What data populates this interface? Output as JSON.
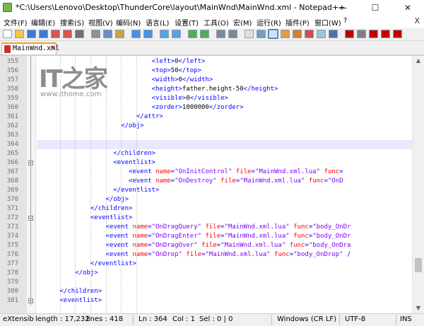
{
  "window": {
    "title": "*C:\\Users\\Lenovo\\Desktop\\ThunderCore\\layout\\MainWnd\\MainWnd.xml - Notepad++",
    "minimize_glyph": "—",
    "maximize_glyph": "☐",
    "close_glyph": "✕"
  },
  "menu": {
    "items": [
      "文件(F)",
      "编辑(E)",
      "搜索(S)",
      "视图(V)",
      "编码(N)",
      "语言(L)",
      "设置(T)",
      "工具(O)",
      "宏(M)",
      "运行(R)",
      "插件(P)",
      "窗口(W)",
      "?"
    ],
    "close_glyph": "X"
  },
  "toolbar": {
    "icons": [
      "new-file-icon",
      "open-file-icon",
      "save-icon",
      "save-all-icon",
      "close-icon",
      "close-all-icon",
      "print-icon",
      "cut-icon",
      "copy-icon",
      "paste-icon",
      "undo-icon",
      "redo-icon",
      "find-icon",
      "replace-icon",
      "zoom-in-icon",
      "zoom-out-icon",
      "sync-vertical-icon",
      "sync-horizontal-icon",
      "word-wrap-icon",
      "all-chars-icon",
      "indent-guide-icon",
      "udl-icon",
      "doc-map-icon",
      "function-list-icon",
      "folder-workspace-icon",
      "monitor-icon",
      "record-macro-icon",
      "stop-macro-icon",
      "play-macro-icon",
      "play-multiple-icon",
      "save-macro-icon"
    ],
    "colors": [
      "#ffffff",
      "#f5c542",
      "#3a7bd5",
      "#3a7bd5",
      "#d9534f",
      "#d9534f",
      "#707070",
      "#909090",
      "#6a8fc7",
      "#c9a24b",
      "#4a90e2",
      "#4a90e2",
      "#5aa0e0",
      "#5aa0e0",
      "#4caf50",
      "#4caf50",
      "#7a8a9a",
      "#7a8a9a",
      "#e0e0e0",
      "#7a9ac0",
      "#3a6ea5",
      "#e0a040",
      "#d08030",
      "#c95050",
      "#a0c0e0",
      "#5070a0",
      "#c00000",
      "#808080",
      "#c00000",
      "#c00000",
      "#c00000"
    ],
    "active_index": 20
  },
  "tab": {
    "label": "MainWnd.xml",
    "close_glyph": "✕"
  },
  "editor": {
    "current_line": 364,
    "lines": [
      {
        "n": "355",
        "indent": 30,
        "parts": [
          [
            "t",
            "<left>"
          ],
          [
            "x",
            "0"
          ],
          [
            "t",
            "</left>"
          ]
        ]
      },
      {
        "n": "356",
        "indent": 30,
        "parts": [
          [
            "t",
            "<top>"
          ],
          [
            "x",
            "50"
          ],
          [
            "t",
            "</top>"
          ]
        ]
      },
      {
        "n": "357",
        "indent": 30,
        "parts": [
          [
            "t",
            "<width>"
          ],
          [
            "x",
            "0"
          ],
          [
            "t",
            "</width>"
          ]
        ]
      },
      {
        "n": "358",
        "indent": 30,
        "parts": [
          [
            "t",
            "<height>"
          ],
          [
            "x",
            "father.height-50"
          ],
          [
            "t",
            "</height>"
          ]
        ]
      },
      {
        "n": "359",
        "indent": 30,
        "parts": [
          [
            "t",
            "<visible>"
          ],
          [
            "x",
            "0"
          ],
          [
            "t",
            "</visible>"
          ]
        ]
      },
      {
        "n": "360",
        "indent": 30,
        "parts": [
          [
            "t",
            "<zorder>"
          ],
          [
            "x",
            "1000000"
          ],
          [
            "t",
            "</zorder>"
          ]
        ]
      },
      {
        "n": "361",
        "indent": 26,
        "parts": [
          [
            "t",
            "</attr>"
          ]
        ]
      },
      {
        "n": "362",
        "indent": 22,
        "parts": [
          [
            "t",
            "</obj>"
          ]
        ]
      },
      {
        "n": "363",
        "indent": 0,
        "parts": []
      },
      {
        "n": "364",
        "indent": 0,
        "parts": []
      },
      {
        "n": "365",
        "indent": 20,
        "parts": [
          [
            "t",
            "</children>"
          ]
        ]
      },
      {
        "n": "366",
        "indent": 20,
        "parts": [
          [
            "t",
            "<eventlist>"
          ]
        ]
      },
      {
        "n": "367",
        "indent": 24,
        "parts": [
          [
            "t",
            "<event "
          ],
          [
            "a",
            "name"
          ],
          [
            "t",
            "="
          ],
          [
            "v",
            "\"OnInitControl\""
          ],
          [
            "t",
            " "
          ],
          [
            "a",
            "file"
          ],
          [
            "t",
            "="
          ],
          [
            "v",
            "\"MainWnd.xml.lua\""
          ],
          [
            "t",
            " "
          ],
          [
            "a",
            "func"
          ],
          [
            "t",
            "="
          ]
        ]
      },
      {
        "n": "368",
        "indent": 24,
        "parts": [
          [
            "t",
            "<event "
          ],
          [
            "a",
            "name"
          ],
          [
            "t",
            "="
          ],
          [
            "v",
            "\"OnDestroy\""
          ],
          [
            "t",
            " "
          ],
          [
            "a",
            "file"
          ],
          [
            "t",
            "="
          ],
          [
            "v",
            "\"MainWnd.xml.lua\""
          ],
          [
            "t",
            " "
          ],
          [
            "a",
            "func"
          ],
          [
            "t",
            "="
          ],
          [
            "v",
            "\"OnD"
          ]
        ]
      },
      {
        "n": "369",
        "indent": 20,
        "parts": [
          [
            "t",
            "</eventlist>"
          ]
        ]
      },
      {
        "n": "370",
        "indent": 18,
        "parts": [
          [
            "t",
            "</obj>"
          ]
        ]
      },
      {
        "n": "371",
        "indent": 14,
        "parts": [
          [
            "t",
            "</children>"
          ]
        ]
      },
      {
        "n": "372",
        "indent": 14,
        "parts": [
          [
            "t",
            "<eventlist>"
          ]
        ]
      },
      {
        "n": "373",
        "indent": 18,
        "parts": [
          [
            "t",
            "<event "
          ],
          [
            "a",
            "name"
          ],
          [
            "t",
            "="
          ],
          [
            "v",
            "\"OnDragQuery\""
          ],
          [
            "t",
            " "
          ],
          [
            "a",
            "file"
          ],
          [
            "t",
            "="
          ],
          [
            "v",
            "\"MainWnd.xml.lua\""
          ],
          [
            "t",
            " "
          ],
          [
            "a",
            "func"
          ],
          [
            "t",
            "="
          ],
          [
            "v",
            "\"body_OnDr"
          ]
        ]
      },
      {
        "n": "374",
        "indent": 18,
        "parts": [
          [
            "t",
            "<event "
          ],
          [
            "a",
            "name"
          ],
          [
            "t",
            "="
          ],
          [
            "v",
            "\"OnDragEnter\""
          ],
          [
            "t",
            " "
          ],
          [
            "a",
            "file"
          ],
          [
            "t",
            "="
          ],
          [
            "v",
            "\"MainWnd.xml.lua\""
          ],
          [
            "t",
            " "
          ],
          [
            "a",
            "func"
          ],
          [
            "t",
            "="
          ],
          [
            "v",
            "\"body_OnDr"
          ]
        ]
      },
      {
        "n": "375",
        "indent": 18,
        "parts": [
          [
            "t",
            "<event "
          ],
          [
            "a",
            "name"
          ],
          [
            "t",
            "="
          ],
          [
            "v",
            "\"OnDragOver\""
          ],
          [
            "t",
            " "
          ],
          [
            "a",
            "file"
          ],
          [
            "t",
            "="
          ],
          [
            "v",
            "\"MainWnd.xml.lua\""
          ],
          [
            "t",
            " "
          ],
          [
            "a",
            "func"
          ],
          [
            "t",
            "="
          ],
          [
            "v",
            "\"body_OnDra"
          ]
        ]
      },
      {
        "n": "376",
        "indent": 18,
        "parts": [
          [
            "t",
            "<event "
          ],
          [
            "a",
            "name"
          ],
          [
            "t",
            "="
          ],
          [
            "v",
            "\"OnDrop\""
          ],
          [
            "t",
            " "
          ],
          [
            "a",
            "file"
          ],
          [
            "t",
            "="
          ],
          [
            "v",
            "\"MainWnd.xml.lua\""
          ],
          [
            "t",
            " "
          ],
          [
            "a",
            "func"
          ],
          [
            "t",
            "="
          ],
          [
            "v",
            "\"body_OnDrop\""
          ],
          [
            "t",
            " /"
          ]
        ]
      },
      {
        "n": "377",
        "indent": 14,
        "parts": [
          [
            "t",
            "</eventlist>"
          ]
        ]
      },
      {
        "n": "378",
        "indent": 10,
        "parts": [
          [
            "t",
            "</obj>"
          ]
        ]
      },
      {
        "n": "379",
        "indent": 0,
        "parts": []
      },
      {
        "n": "380",
        "indent": 6,
        "parts": [
          [
            "t",
            "</children>"
          ]
        ]
      },
      {
        "n": "381",
        "indent": 6,
        "parts": [
          [
            "t",
            "<eventlist>"
          ]
        ]
      }
    ],
    "fold_lines": [
      "366",
      "372",
      "381"
    ]
  },
  "watermark": {
    "logo": "IT之家",
    "url": "www.ithome.com"
  },
  "scrollbar": {
    "up_glyph": "▲",
    "down_glyph": "▼"
  },
  "status": {
    "file_type": "eXtensib",
    "length": "length : 17,232",
    "lines": "lines : 418",
    "ln": "Ln : 364",
    "col": "Col : 1",
    "sel": "Sel : 0 | 0",
    "eol": "Windows (CR LF)",
    "encoding": "UTF-8",
    "mode": "INS"
  }
}
